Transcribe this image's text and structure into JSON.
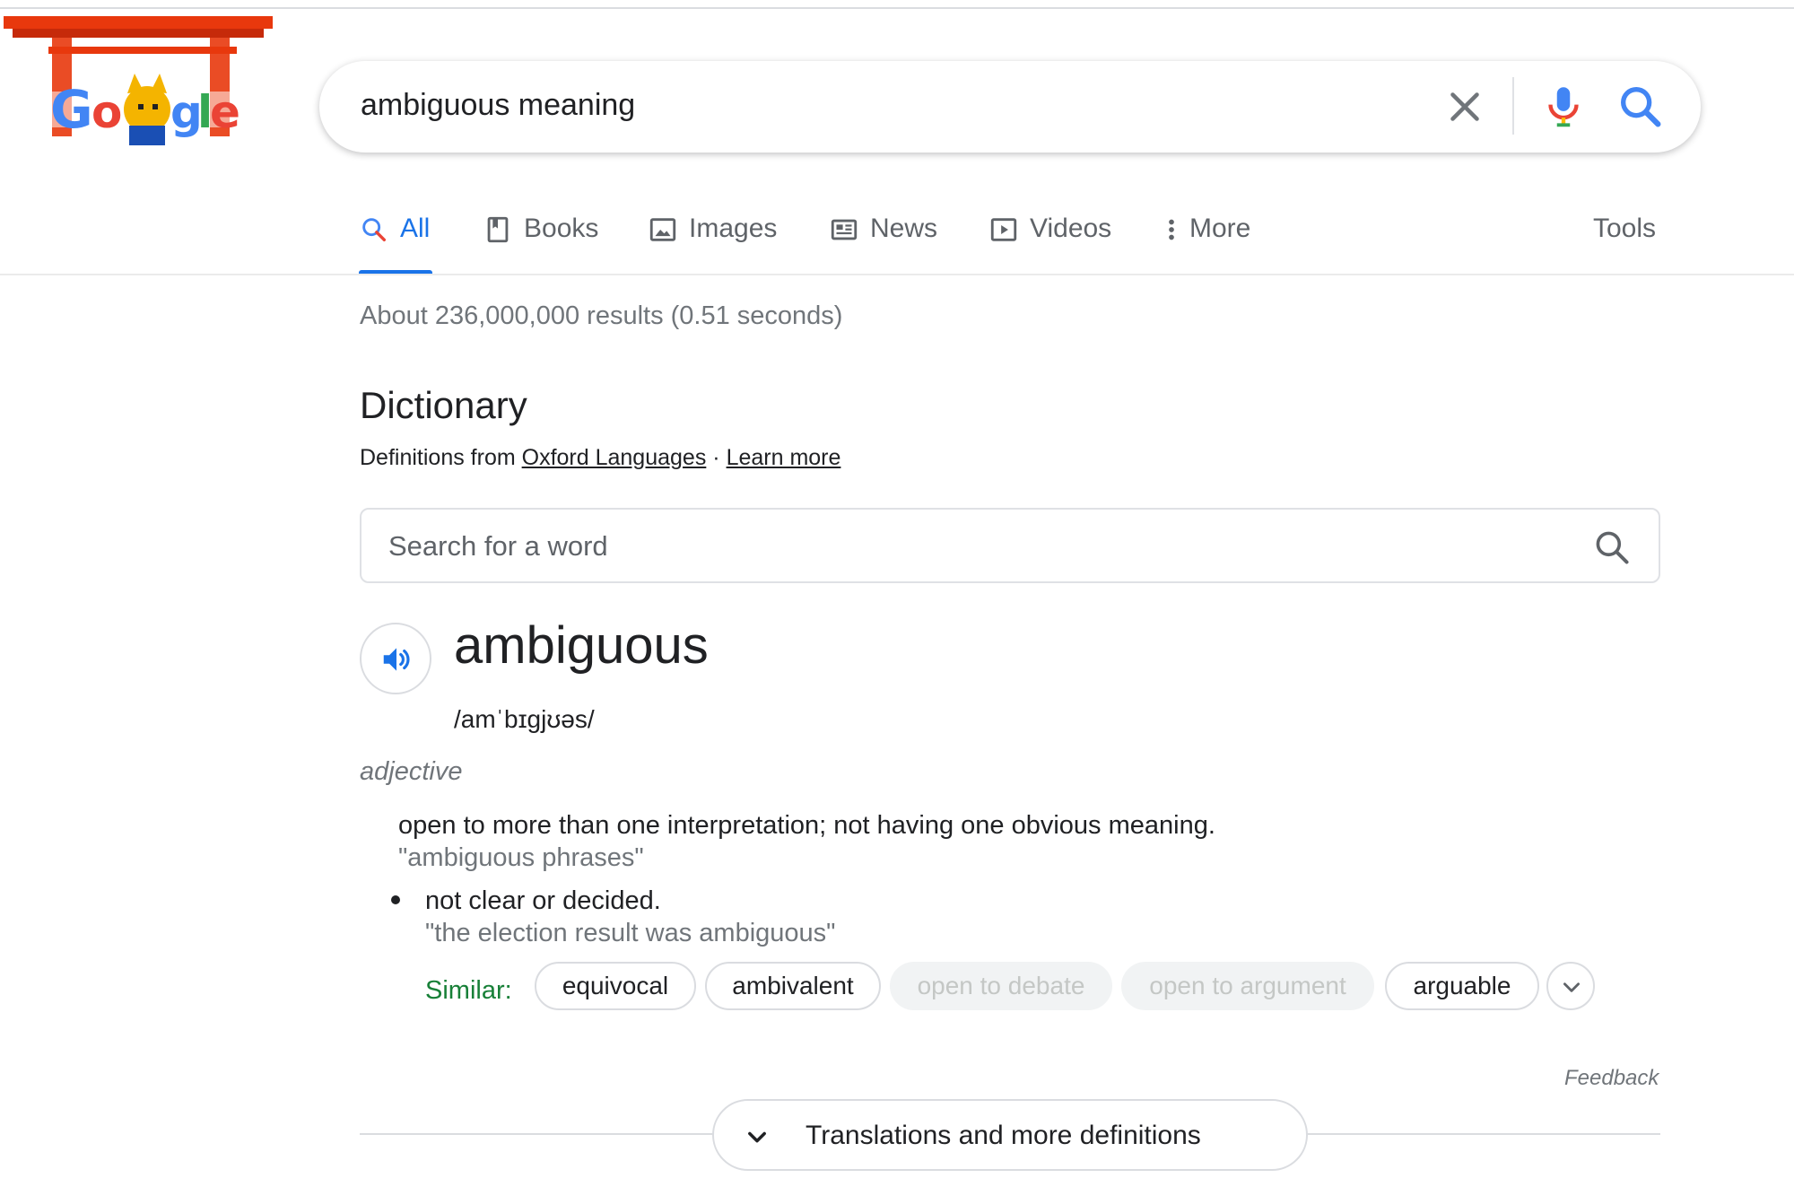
{
  "search": {
    "query": "ambiguous meaning"
  },
  "tabs": [
    {
      "label": "All",
      "icon": "search-icon",
      "active": true
    },
    {
      "label": "Books",
      "icon": "book-icon"
    },
    {
      "label": "Images",
      "icon": "image-icon"
    },
    {
      "label": "News",
      "icon": "news-icon"
    },
    {
      "label": "Videos",
      "icon": "video-icon"
    },
    {
      "label": "More",
      "icon": "more-vert-icon"
    }
  ],
  "tools_label": "Tools",
  "result_stats": "About 236,000,000 results (0.51 seconds)",
  "dictionary": {
    "title": "Dictionary",
    "source_prefix": "Definitions from",
    "source_link": "Oxford Languages",
    "separator": "·",
    "learn_more": "Learn more",
    "search_placeholder": "Search for a word",
    "headword": "ambiguous",
    "phonetic": "/amˈbɪɡjʊəs/",
    "part_of_speech": "adjective",
    "senses": [
      {
        "definition": "open to more than one interpretation; not having one obvious meaning.",
        "example": "\"ambiguous phrases\""
      },
      {
        "definition": "not clear or decided.",
        "example": "\"the election result was ambiguous\""
      }
    ],
    "similar_label": "Similar:",
    "similar": [
      {
        "word": "equivocal",
        "style": "outline"
      },
      {
        "word": "ambivalent",
        "style": "outline"
      },
      {
        "word": "open to debate",
        "style": "muted"
      },
      {
        "word": "open to argument",
        "style": "muted"
      },
      {
        "word": "arguable",
        "style": "outline"
      }
    ],
    "feedback": "Feedback",
    "more_button": "Translations and more definitions"
  },
  "colors": {
    "accent_blue": "#1a73e8",
    "similar_green": "#188038",
    "secondary_text": "#70757a"
  }
}
